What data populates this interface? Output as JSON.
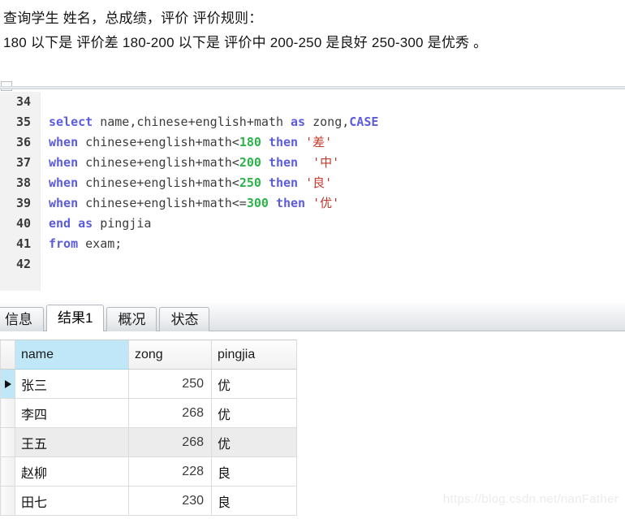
{
  "notes": {
    "line1": "查询学生 姓名，总成绩，评价 评价规则：",
    "line2": "180 以下是 评价差   180-200 以下是 评价中 200-250 是良好 250-300 是优秀 。"
  },
  "editor": {
    "lines": [
      {
        "number": "34",
        "tokens": []
      },
      {
        "number": "35",
        "tokens": [
          {
            "t": "select",
            "c": "kw"
          },
          {
            "t": " ",
            "c": "op"
          },
          {
            "t": "name",
            "c": "id"
          },
          {
            "t": ",",
            "c": "op"
          },
          {
            "t": "chinese",
            "c": "id"
          },
          {
            "t": "+",
            "c": "op"
          },
          {
            "t": "english",
            "c": "id"
          },
          {
            "t": "+",
            "c": "op"
          },
          {
            "t": "math",
            "c": "id"
          },
          {
            "t": " ",
            "c": "op"
          },
          {
            "t": "as",
            "c": "kw"
          },
          {
            "t": " ",
            "c": "op"
          },
          {
            "t": "zong",
            "c": "id"
          },
          {
            "t": ",",
            "c": "op"
          },
          {
            "t": "CASE",
            "c": "kw"
          }
        ]
      },
      {
        "number": "36",
        "tokens": [
          {
            "t": "when",
            "c": "kw"
          },
          {
            "t": " ",
            "c": "op"
          },
          {
            "t": "chinese",
            "c": "id"
          },
          {
            "t": "+",
            "c": "op"
          },
          {
            "t": "english",
            "c": "id"
          },
          {
            "t": "+",
            "c": "op"
          },
          {
            "t": "math",
            "c": "id"
          },
          {
            "t": "<",
            "c": "op"
          },
          {
            "t": "180",
            "c": "num"
          },
          {
            "t": " ",
            "c": "op"
          },
          {
            "t": "then",
            "c": "kw"
          },
          {
            "t": " ",
            "c": "op"
          },
          {
            "t": "'差'",
            "c": "str"
          }
        ]
      },
      {
        "number": "37",
        "tokens": [
          {
            "t": "when",
            "c": "kw"
          },
          {
            "t": " ",
            "c": "op"
          },
          {
            "t": "chinese",
            "c": "id"
          },
          {
            "t": "+",
            "c": "op"
          },
          {
            "t": "english",
            "c": "id"
          },
          {
            "t": "+",
            "c": "op"
          },
          {
            "t": "math",
            "c": "id"
          },
          {
            "t": "<",
            "c": "op"
          },
          {
            "t": "200",
            "c": "num"
          },
          {
            "t": " ",
            "c": "op"
          },
          {
            "t": "then",
            "c": "kw"
          },
          {
            "t": "  ",
            "c": "op"
          },
          {
            "t": "'中'",
            "c": "str"
          }
        ]
      },
      {
        "number": "38",
        "tokens": [
          {
            "t": "when",
            "c": "kw"
          },
          {
            "t": " ",
            "c": "op"
          },
          {
            "t": "chinese",
            "c": "id"
          },
          {
            "t": "+",
            "c": "op"
          },
          {
            "t": "english",
            "c": "id"
          },
          {
            "t": "+",
            "c": "op"
          },
          {
            "t": "math",
            "c": "id"
          },
          {
            "t": "<",
            "c": "op"
          },
          {
            "t": "250",
            "c": "num"
          },
          {
            "t": " ",
            "c": "op"
          },
          {
            "t": "then",
            "c": "kw"
          },
          {
            "t": " ",
            "c": "op"
          },
          {
            "t": "'良'",
            "c": "str"
          }
        ]
      },
      {
        "number": "39",
        "tokens": [
          {
            "t": "when",
            "c": "kw"
          },
          {
            "t": " ",
            "c": "op"
          },
          {
            "t": "chinese",
            "c": "id"
          },
          {
            "t": "+",
            "c": "op"
          },
          {
            "t": "english",
            "c": "id"
          },
          {
            "t": "+",
            "c": "op"
          },
          {
            "t": "math",
            "c": "id"
          },
          {
            "t": "<=",
            "c": "op"
          },
          {
            "t": "300",
            "c": "num"
          },
          {
            "t": " ",
            "c": "op"
          },
          {
            "t": "then",
            "c": "kw"
          },
          {
            "t": " ",
            "c": "op"
          },
          {
            "t": "'优'",
            "c": "str"
          }
        ]
      },
      {
        "number": "40",
        "tokens": [
          {
            "t": "end",
            "c": "kw"
          },
          {
            "t": " ",
            "c": "op"
          },
          {
            "t": "as",
            "c": "kw"
          },
          {
            "t": " ",
            "c": "op"
          },
          {
            "t": "pingjia",
            "c": "id"
          }
        ]
      },
      {
        "number": "41",
        "tokens": [
          {
            "t": "from",
            "c": "kw"
          },
          {
            "t": " ",
            "c": "op"
          },
          {
            "t": "exam",
            "c": "id"
          },
          {
            "t": ";",
            "c": "op"
          }
        ]
      },
      {
        "number": "42",
        "tokens": []
      }
    ]
  },
  "tabs": [
    {
      "label": "信息",
      "active": false
    },
    {
      "label": "结果1",
      "active": true
    },
    {
      "label": "概况",
      "active": false
    },
    {
      "label": "状态",
      "active": false
    }
  ],
  "result_grid": {
    "columns": [
      "name",
      "zong",
      "pingjia"
    ],
    "selected_column": "name",
    "current_row_index": 0,
    "rows": [
      {
        "name": "张三",
        "zong": "250",
        "pingjia": "优"
      },
      {
        "name": "李四",
        "zong": "268",
        "pingjia": "优"
      },
      {
        "name": "王五",
        "zong": "268",
        "pingjia": "优"
      },
      {
        "name": "赵柳",
        "zong": "228",
        "pingjia": "良"
      },
      {
        "name": "田七",
        "zong": "230",
        "pingjia": "良"
      }
    ]
  },
  "watermark": "https://blog.csdn.net/nanFather",
  "colors": {
    "keyword": "#5c5cdb",
    "number": "#2bb34a",
    "string": "#c0392b",
    "identifier": "#3c3c3c",
    "selected_header": "#bfe7f7",
    "alt_row": "#ececec"
  }
}
